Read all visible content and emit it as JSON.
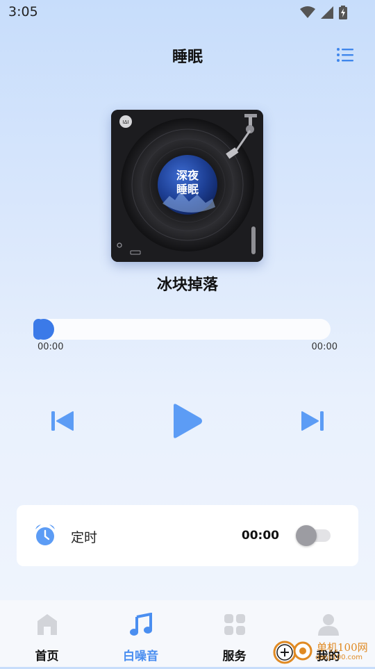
{
  "status_bar": {
    "time": "3:05"
  },
  "header": {
    "title": "睡眠"
  },
  "album": {
    "cover_text_line1": "深夜",
    "cover_text_line2": "睡眠",
    "badge": "ΙΔΙ"
  },
  "player": {
    "track_title": "冰块掉落",
    "current_time": "00:00",
    "total_time": "00:00",
    "progress": 0.0
  },
  "timer": {
    "label": "定时",
    "value": "00:00",
    "enabled": false
  },
  "tabs": [
    {
      "label": "首页",
      "icon": "home-icon",
      "active": false
    },
    {
      "label": "白噪音",
      "icon": "music-note-icon",
      "active": true
    },
    {
      "label": "服务",
      "icon": "grid-icon",
      "active": false
    },
    {
      "label": "我的",
      "icon": "person-icon",
      "active": false
    }
  ],
  "watermark": {
    "text": "单机100网",
    "sub": "danji100.com"
  },
  "colors": {
    "accent": "#3b7ae8",
    "control": "#5c9cf5",
    "tab_active": "#4a8ef0",
    "icon_inactive": "#d2d4d9"
  }
}
